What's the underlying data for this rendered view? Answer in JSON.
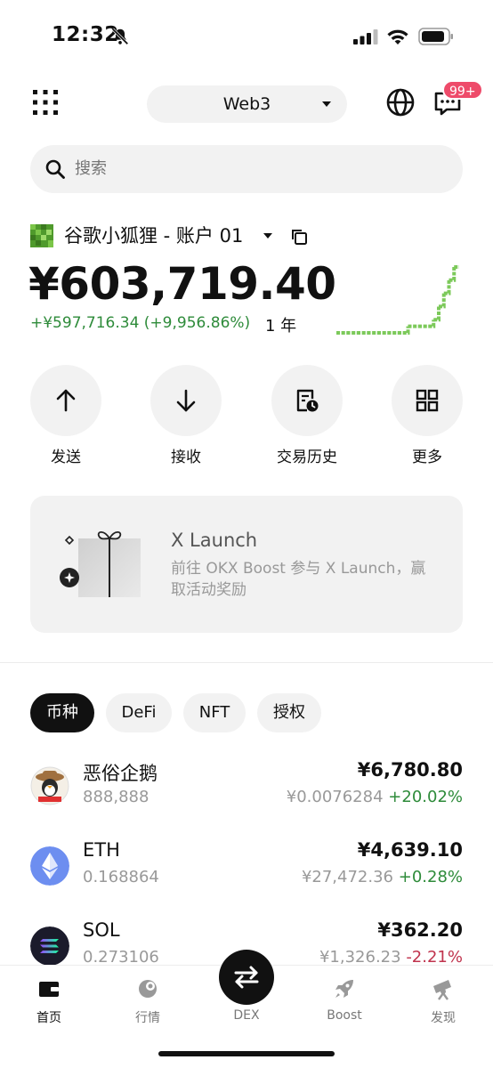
{
  "status_bar": {
    "time": "12:32"
  },
  "header": {
    "network_label": "Web3",
    "message_badge": "99+"
  },
  "search": {
    "placeholder": "搜索"
  },
  "account": {
    "name": "谷歌小狐狸 - 账户 01",
    "balance": "¥603,719.40",
    "pnl": "+¥597,716.34 (+9,956.86%)",
    "period": "1 年"
  },
  "actions": [
    {
      "label": "发送",
      "icon": "arrow-up-icon"
    },
    {
      "label": "接收",
      "icon": "arrow-down-icon"
    },
    {
      "label": "交易历史",
      "icon": "history-icon"
    },
    {
      "label": "更多",
      "icon": "grid-more-icon"
    }
  ],
  "promo": {
    "title": "X Launch",
    "description": "前往 OKX Boost 参与 X Launch，赢取活动奖励"
  },
  "tabs": [
    {
      "label": "币种",
      "active": true
    },
    {
      "label": "DeFi",
      "active": false
    },
    {
      "label": "NFT",
      "active": false
    },
    {
      "label": "授权",
      "active": false
    }
  ],
  "assets": [
    {
      "name": "恶俗企鹅",
      "quantity": "888,888",
      "value": "¥6,780.80",
      "price": "¥0.0076284",
      "change": "+20.02%",
      "direction": "up"
    },
    {
      "name": "ETH",
      "quantity": "0.168864",
      "value": "¥4,639.10",
      "price": "¥27,472.36",
      "change": "+0.28%",
      "direction": "up"
    },
    {
      "name": "SOL",
      "quantity": "0.273106",
      "value": "¥362.20",
      "price": "¥1,326.23",
      "change": "-2.21%",
      "direction": "down"
    }
  ],
  "bottom_nav": [
    {
      "label": "首页",
      "icon": "wallet-icon",
      "active": true
    },
    {
      "label": "行情",
      "icon": "market-icon",
      "active": false
    },
    {
      "label": "DEX",
      "icon": "swap-icon",
      "active": false
    },
    {
      "label": "Boost",
      "icon": "rocket-icon",
      "active": false
    },
    {
      "label": "发现",
      "icon": "telescope-icon",
      "active": false
    }
  ],
  "colors": {
    "up": "#2e8b3a",
    "down": "#c0334d",
    "badge": "#ee4b6a",
    "sparkline": "#7cc95a"
  },
  "sparkline_values": [
    0,
    0,
    0,
    0,
    0,
    0,
    0,
    0,
    0,
    0,
    0,
    0,
    0,
    0,
    1,
    1,
    1,
    1,
    1,
    2,
    4,
    6,
    8,
    10,
    10
  ]
}
